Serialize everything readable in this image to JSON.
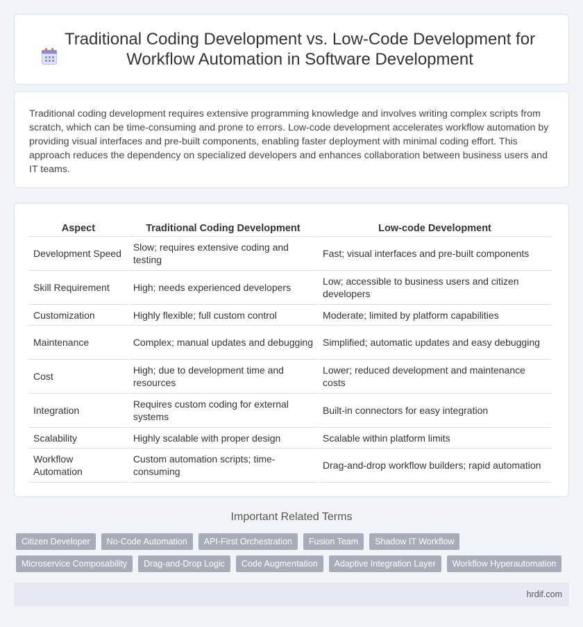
{
  "page": {
    "title": "Traditional Coding Development vs. Low-Code Development for Workflow Automation in Software Development",
    "intro": "Traditional coding development requires extensive programming knowledge and involves writing complex scripts from scratch, which can be time-consuming and prone to errors. Low-code development accelerates workflow automation by providing visual interfaces and pre-built components, enabling faster deployment with minimal coding effort. This approach reduces the dependency on specialized developers and enhances collaboration between business users and IT teams."
  },
  "table": {
    "headers": [
      "Aspect",
      "Traditional Coding Development",
      "Low-code Development"
    ],
    "rows": [
      [
        "Development Speed",
        "Slow; requires extensive coding and testing",
        "Fast; visual interfaces and pre-built components"
      ],
      [
        "Skill Requirement",
        "High; needs experienced developers",
        "Low; accessible to business users and citizen developers"
      ],
      [
        "Customization",
        "Highly flexible; full custom control",
        "Moderate; limited by platform capabilities"
      ],
      [
        "Maintenance",
        "Complex; manual updates and debugging",
        "Simplified; automatic updates and easy debugging"
      ],
      [
        "Cost",
        "High; due to development time and resources",
        "Lower; reduced development and maintenance costs"
      ],
      [
        "Integration",
        "Requires custom coding for external systems",
        "Built-in connectors for easy integration"
      ],
      [
        "Scalability",
        "Highly scalable with proper design",
        "Scalable within platform limits"
      ],
      [
        "Workflow Automation",
        "Custom automation scripts; time-consuming",
        "Drag-and-drop workflow builders; rapid automation"
      ]
    ]
  },
  "related": {
    "title": "Important Related Terms",
    "tags": [
      "Citizen Developer",
      "No-Code Automation",
      "API-First Orchestration",
      "Fusion Team",
      "Shadow IT Workflow",
      "Microservice Composability",
      "Drag-and-Drop Logic",
      "Code Augmentation",
      "Adaptive Integration Layer",
      "Workflow Hyperautomation"
    ]
  },
  "footer": {
    "site": "hrdif.com"
  },
  "icons": {
    "title_icon": "calendar-icon"
  }
}
